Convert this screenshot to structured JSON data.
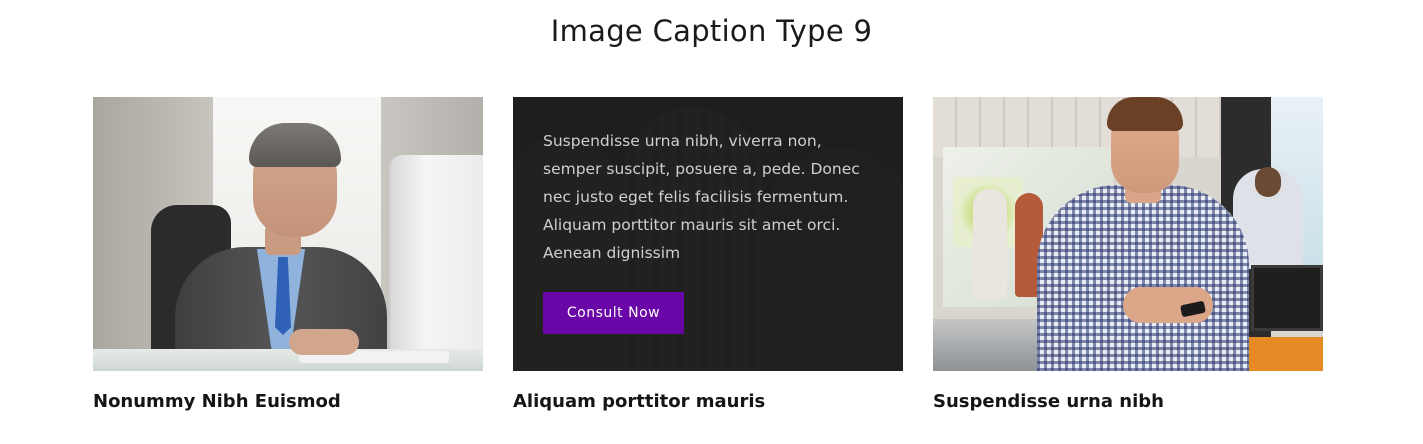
{
  "section": {
    "title": "Image Caption Type 9"
  },
  "cards": [
    {
      "caption": "Nonummy Nibh Euismod"
    },
    {
      "caption": "Aliquam porttitor mauris",
      "overlay_text": "Suspendisse urna nibh, viverra non, semper suscipit, posuere a, pede. Donec nec justo eget felis facilisis fermentum. Aliquam porttitor mauris sit amet orci. Aenean dignissim",
      "button_label": "Consult Now"
    },
    {
      "caption": "Suspendisse urna nibh"
    }
  ],
  "colors": {
    "button": "#6a05a8",
    "overlay": "#191818"
  }
}
